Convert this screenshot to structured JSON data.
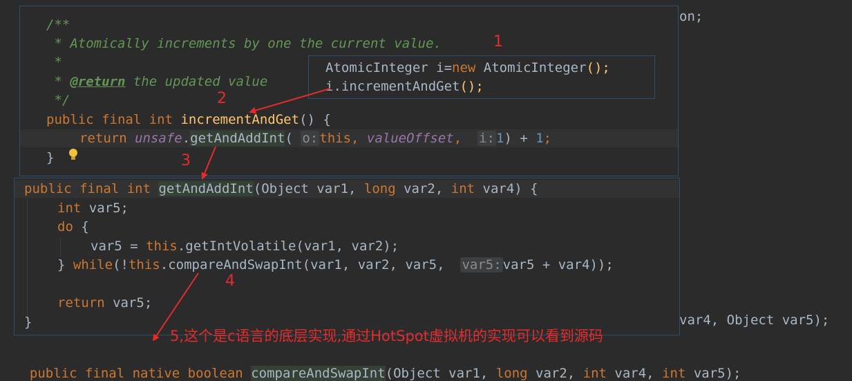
{
  "background_code": {
    "top_right": "on;",
    "bottom_right": "var4, Object var5);"
  },
  "popup1": {
    "doc_open": "/**",
    "doc_line1": " * Atomically increments by one the current value.",
    "doc_star": " *",
    "doc_return_prefix": " * ",
    "doc_return_tag": "@return",
    "doc_return_text": " the updated value",
    "doc_close": " */",
    "sig_kw": "public final int ",
    "sig_name": "incrementAndGet",
    "sig_rest": "() {",
    "body_return": "return ",
    "body_field": "unsafe",
    "body_dot": ".",
    "body_method": "getAndAddInt",
    "body_paren": "(",
    "hint_o": "o:",
    "body_this": "this",
    "body_comma": ", ",
    "body_offset": "valueOffset",
    "body_comma2": ", ",
    "hint_i": "i:",
    "body_one": "1",
    "body_tail": ") + ",
    "body_one2": "1",
    "body_semi": ";",
    "close_brace": "}"
  },
  "snippet": {
    "line1_type": "AtomicInteger i=",
    "line1_new": "new",
    "line1_rest": " AtomicInteger",
    "line1_paren": "();",
    "line2": "i.incrementAndGet",
    "line2_paren": "();"
  },
  "popup2": {
    "sig_kw": "public final int ",
    "sig_name": "getAndAddInt",
    "sig_params_1": "(Object var1, ",
    "sig_long": "long",
    "sig_params_2": " var2, ",
    "sig_int": "int",
    "sig_params_3": " var4) {",
    "decl_kw": "int",
    "decl_var": " var5;",
    "do_kw": "do",
    "do_brace": " {",
    "assign_1": "var5 = ",
    "assign_this": "this",
    "assign_2": ".getIntVolatile(var1, var2);",
    "while_brace": "} ",
    "while_kw": "while",
    "while_1": "(!",
    "while_this": "this",
    "while_2": ".compareAndSwapInt(var1, var2, var5, ",
    "hint_var5": "var5:",
    "while_3": "var5 + var4));",
    "return_kw": "return",
    "return_var": " var5;",
    "close_brace": "}"
  },
  "bottom_line": {
    "kw": "public final native boolean ",
    "name": "compareAndSwapInt",
    "p1": "(Object var1, ",
    "long": "long",
    "p2": " var2, ",
    "int1": "int",
    "p3": " var4, ",
    "int2": "int",
    "p4": " var5);"
  },
  "annotations": {
    "n1": "1",
    "n2": "2",
    "n3": "3",
    "n4": "4",
    "n5_text": "5,这个是c语言的底层实现,通过HotSpot虚拟机的实现可以看到源码"
  },
  "colors": {
    "background": "#2b2b2b",
    "keyword": "#cc7832",
    "method": "#ffc66d",
    "number": "#6897bb",
    "doc": "#629755",
    "annotation_red": "#e52b2b",
    "popup_border": "#2f4d6e"
  }
}
